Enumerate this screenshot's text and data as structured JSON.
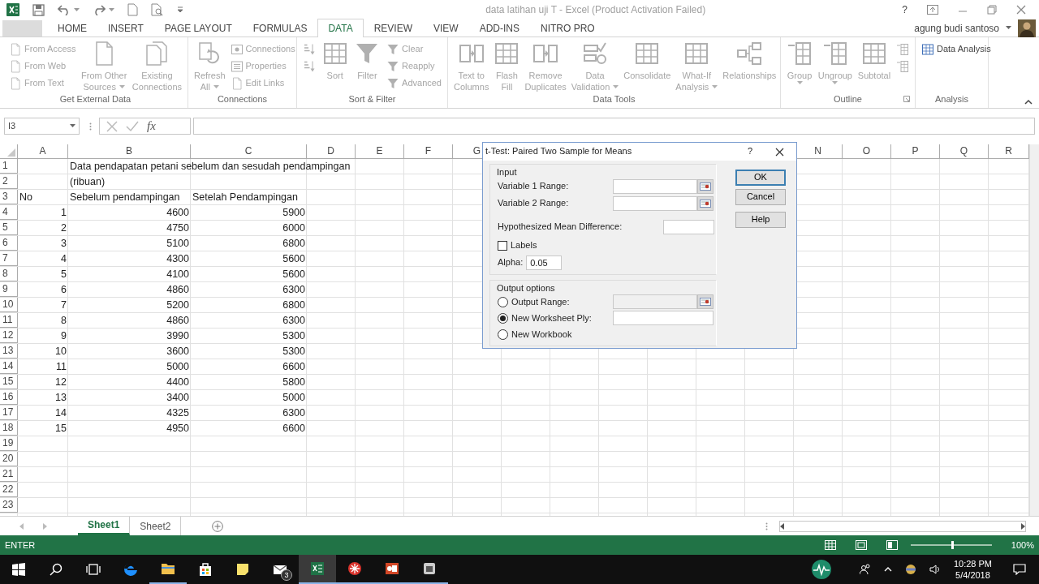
{
  "title_bar": {
    "title": "data latihan uji T - Excel (Product Activation Failed)",
    "help": "?"
  },
  "tabs": [
    {
      "label": "HOME",
      "selected": false
    },
    {
      "label": "INSERT",
      "selected": false
    },
    {
      "label": "PAGE LAYOUT",
      "selected": false
    },
    {
      "label": "FORMULAS",
      "selected": false
    },
    {
      "label": "DATA",
      "selected": true
    },
    {
      "label": "REVIEW",
      "selected": false
    },
    {
      "label": "VIEW",
      "selected": false
    },
    {
      "label": "ADD-INS",
      "selected": false
    },
    {
      "label": "NITRO PRO",
      "selected": false
    }
  ],
  "user": {
    "name": "agung budi santoso"
  },
  "ribbon": {
    "groups": [
      {
        "label": "Get External Data",
        "items": [
          {
            "kind": "small",
            "lines": [
              "From Access"
            ],
            "disabled": true
          },
          {
            "kind": "small",
            "lines": [
              "From Web"
            ],
            "disabled": true
          },
          {
            "kind": "small",
            "lines": [
              "From Text"
            ],
            "disabled": true
          },
          {
            "kind": "large",
            "lines": [
              "From Other",
              "Sources"
            ],
            "disabled": true,
            "dropdown": true
          },
          {
            "kind": "large",
            "lines": [
              "Existing",
              "Connections"
            ],
            "disabled": true
          }
        ]
      },
      {
        "label": "Connections",
        "items": [
          {
            "kind": "large",
            "lines": [
              "Refresh",
              "All"
            ],
            "disabled": true,
            "dropdown": true
          },
          {
            "kind": "small",
            "lines": [
              "Connections"
            ],
            "disabled": true
          },
          {
            "kind": "small",
            "lines": [
              "Properties"
            ],
            "disabled": true
          },
          {
            "kind": "small",
            "lines": [
              "Edit Links"
            ],
            "disabled": true
          }
        ]
      },
      {
        "label": "Sort & Filter",
        "items": [
          {
            "kind": "icon",
            "disabled": true
          },
          {
            "kind": "icon",
            "disabled": true
          },
          {
            "kind": "large",
            "lines": [
              "Sort"
            ],
            "disabled": true
          },
          {
            "kind": "large",
            "lines": [
              "Filter"
            ],
            "disabled": true
          },
          {
            "kind": "small",
            "lines": [
              "Clear"
            ],
            "disabled": true
          },
          {
            "kind": "small",
            "lines": [
              "Reapply"
            ],
            "disabled": true
          },
          {
            "kind": "small",
            "lines": [
              "Advanced"
            ],
            "disabled": true
          }
        ]
      },
      {
        "label": "Data Tools",
        "items": [
          {
            "kind": "large",
            "lines": [
              "Text to",
              "Columns"
            ],
            "disabled": true
          },
          {
            "kind": "large",
            "lines": [
              "Flash",
              "Fill"
            ],
            "disabled": true
          },
          {
            "kind": "large",
            "lines": [
              "Remove",
              "Duplicates"
            ],
            "disabled": true
          },
          {
            "kind": "large",
            "lines": [
              "Data",
              "Validation"
            ],
            "disabled": true,
            "dropdown": true
          },
          {
            "kind": "large",
            "lines": [
              "Consolidate"
            ],
            "disabled": true
          },
          {
            "kind": "large",
            "lines": [
              "What-If",
              "Analysis"
            ],
            "disabled": true,
            "dropdown": true
          },
          {
            "kind": "large",
            "lines": [
              "Relationships"
            ],
            "disabled": true
          }
        ]
      },
      {
        "label": "Outline",
        "launcher": true,
        "items": [
          {
            "kind": "large",
            "lines": [
              "Group"
            ],
            "disabled": true,
            "dropdown": true
          },
          {
            "kind": "large",
            "lines": [
              "Ungroup"
            ],
            "disabled": true,
            "dropdown": true
          },
          {
            "kind": "large",
            "lines": [
              "Subtotal"
            ],
            "disabled": true
          },
          {
            "kind": "icon",
            "disabled": true
          },
          {
            "kind": "icon",
            "disabled": true
          }
        ]
      },
      {
        "label": "Analysis",
        "items": [
          {
            "kind": "small",
            "lines": [
              "Data Analysis"
            ],
            "disabled": false
          }
        ]
      }
    ]
  },
  "formula_bar": {
    "name_box": "I3",
    "function_label": "fx"
  },
  "sheet": {
    "columns": [
      {
        "label": "A"
      },
      {
        "label": "B"
      },
      {
        "label": "C"
      },
      {
        "label": "D"
      },
      {
        "label": "E"
      },
      {
        "label": "F"
      },
      {
        "label": "G"
      },
      {
        "label": "N"
      },
      {
        "label": "O"
      },
      {
        "label": "P"
      },
      {
        "label": "Q"
      },
      {
        "label": "R"
      }
    ],
    "rows": [
      {
        "header": "1",
        "kind": "title",
        "b": "Data pendapatan petani sebelum dan sesudah pendampingan"
      },
      {
        "header": "2",
        "kind": "text",
        "b": "(ribuan)"
      },
      {
        "header": "3",
        "kind": "text",
        "a": "No",
        "b": "Sebelum pendampingan",
        "c": "Setelah Pendampingan"
      },
      {
        "header": "4",
        "kind": "numbers",
        "a": "1",
        "b": "4600",
        "c": "5900"
      },
      {
        "header": "5",
        "kind": "numbers",
        "a": "2",
        "b": "4750",
        "c": "6000"
      },
      {
        "header": "6",
        "kind": "numbers",
        "a": "3",
        "b": "5100",
        "c": "6800"
      },
      {
        "header": "7",
        "kind": "numbers",
        "a": "4",
        "b": "4300",
        "c": "5600"
      },
      {
        "header": "8",
        "kind": "numbers",
        "a": "5",
        "b": "4100",
        "c": "5600"
      },
      {
        "header": "9",
        "kind": "numbers",
        "a": "6",
        "b": "4860",
        "c": "6300"
      },
      {
        "header": "10",
        "kind": "numbers",
        "a": "7",
        "b": "5200",
        "c": "6800"
      },
      {
        "header": "11",
        "kind": "numbers",
        "a": "8",
        "b": "4860",
        "c": "6300"
      },
      {
        "header": "12",
        "kind": "numbers",
        "a": "9",
        "b": "3990",
        "c": "5300"
      },
      {
        "header": "13",
        "kind": "numbers",
        "a": "10",
        "b": "3600",
        "c": "5300"
      },
      {
        "header": "14",
        "kind": "numbers",
        "a": "11",
        "b": "5000",
        "c": "6600"
      },
      {
        "header": "15",
        "kind": "numbers",
        "a": "12",
        "b": "4400",
        "c": "5800"
      },
      {
        "header": "16",
        "kind": "numbers",
        "a": "13",
        "b": "3400",
        "c": "5000"
      },
      {
        "header": "17",
        "kind": "numbers",
        "a": "14",
        "b": "4325",
        "c": "6300"
      },
      {
        "header": "18",
        "kind": "numbers",
        "a": "15",
        "b": "4950",
        "c": "6600"
      },
      {
        "header": "19",
        "kind": "text"
      },
      {
        "header": "20",
        "kind": "text"
      },
      {
        "header": "21",
        "kind": "text"
      },
      {
        "header": "22",
        "kind": "text"
      },
      {
        "header": "23",
        "kind": "text"
      }
    ]
  },
  "dialog": {
    "title": "t-Test: Paired Two Sample for Means",
    "help": "?",
    "input": {
      "label": "Input",
      "fields": [
        {
          "label": "Variable 1 Range:",
          "kind": "range"
        },
        {
          "label": "Variable 2 Range:",
          "kind": "range"
        },
        {
          "label": "Hypothesized Mean Difference:",
          "kind": "text"
        }
      ],
      "labels_checkbox": {
        "label": "Labels",
        "checked": false
      },
      "alpha": {
        "label": "Alpha:",
        "value": "0.05"
      }
    },
    "output": {
      "label": "Output options",
      "options": [
        {
          "label": "Output Range:",
          "selected": false,
          "kind": "range"
        },
        {
          "label": "New Worksheet Ply:",
          "selected": true,
          "kind": "text"
        },
        {
          "label": "New Workbook",
          "selected": false,
          "kind": "none"
        }
      ]
    },
    "buttons": [
      {
        "label": "OK",
        "default": true
      },
      {
        "label": "Cancel",
        "default": false
      },
      {
        "label": "Help",
        "default": false
      }
    ]
  },
  "sheet_tabs": [
    {
      "label": "Sheet1",
      "selected": true
    },
    {
      "label": "Sheet2",
      "selected": false
    }
  ],
  "status_bar": {
    "mode": "ENTER",
    "zoom": {
      "level": 0.5,
      "reading": "100%"
    }
  },
  "taskbar": {
    "apps": [
      {
        "running": false,
        "active": false
      },
      {
        "running": true,
        "active": false
      },
      {
        "running": false,
        "active": false
      },
      {
        "running": false,
        "active": false
      },
      {
        "running": false,
        "active": false,
        "badge": "3"
      },
      {
        "running": true,
        "active": true
      },
      {
        "running": true,
        "active": false
      },
      {
        "running": true,
        "active": false
      },
      {
        "running": true,
        "active": false
      }
    ],
    "time": "10:28 PM",
    "date": "5/4/2018"
  }
}
